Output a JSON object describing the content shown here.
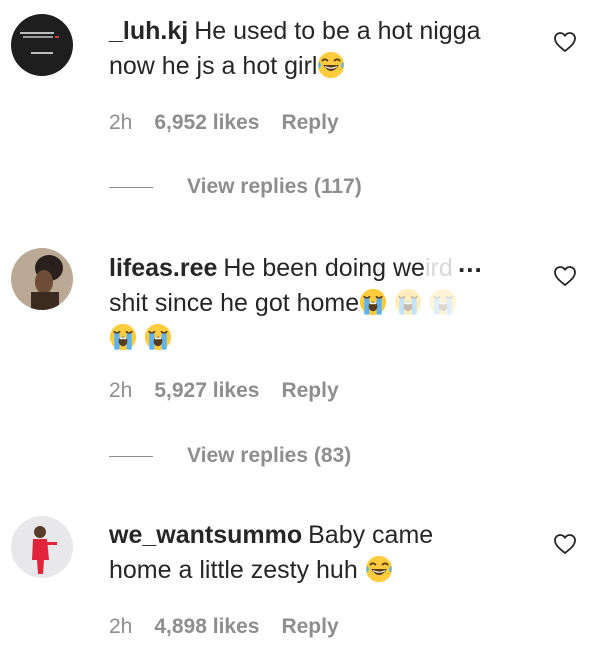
{
  "comments": [
    {
      "username": "_luh.kj",
      "text_lines": [
        "He used to be a hot nigga",
        "now he js a hot girl"
      ],
      "emoji_end": "laughing-tears",
      "time": "2h",
      "likes": "6,952 likes",
      "reply": "Reply",
      "view_replies": "View replies (117)"
    },
    {
      "username": "lifeas.ree",
      "text_line1": "He been doing we",
      "text_line1_faded": "ird",
      "ellipsis": "...",
      "text_line2": "shit since he got home",
      "emojis": [
        "loudly-crying",
        "loudly-crying",
        "loudly-crying",
        "loudly-crying",
        "loudly-crying"
      ],
      "time": "2h",
      "likes": "5,927 likes",
      "reply": "Reply",
      "view_replies": "View replies (83)"
    },
    {
      "username": "we_wantsummo",
      "text_lines": [
        "Baby came",
        "home a little zesty huh"
      ],
      "emoji_end": "laughing-tears",
      "time": "2h",
      "likes": "4,898 likes",
      "reply": "Reply"
    }
  ],
  "colors": {
    "text": "#262626",
    "secondary": "#8e8e8e",
    "background": "#ffffff"
  },
  "icons": {
    "like": "heart-outline-icon",
    "laughing": "face-with-tears-of-joy-emoji",
    "crying": "loudly-crying-face-emoji"
  }
}
